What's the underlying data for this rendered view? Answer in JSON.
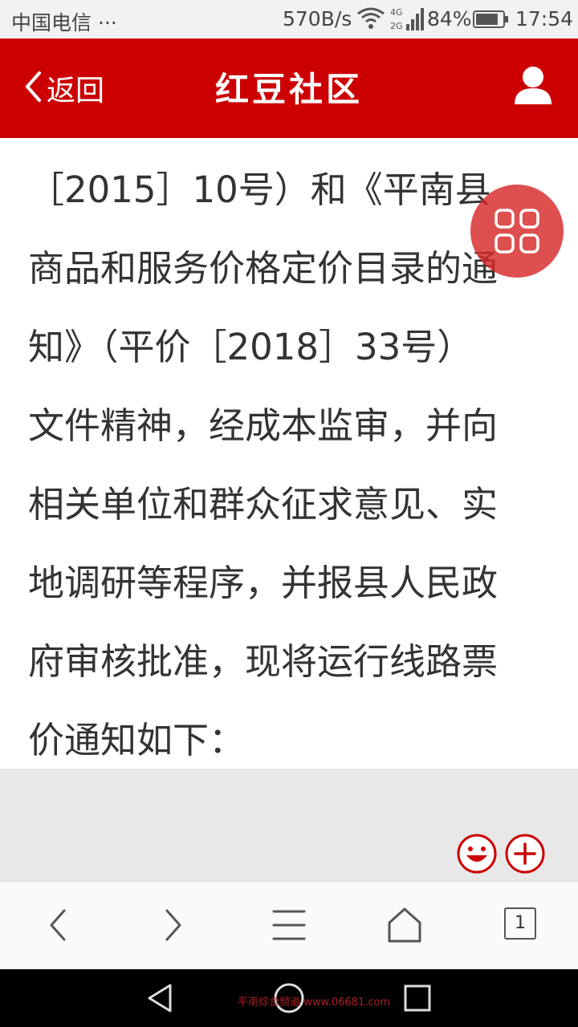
{
  "status_bar": {
    "carrier": "中国电信 ···",
    "net_speed": "570B/s",
    "network_label": "4G 2G",
    "battery_percent": "84%",
    "battery_level": 0.84,
    "time": "17:54"
  },
  "header": {
    "back_label": "返回",
    "title": "红豆社区",
    "background": "#cc0000"
  },
  "article": {
    "lines": [
      "［2015］10号）和《平南县",
      "商品和服务价格定价目录的通",
      "知》（平价［2018］33号）",
      "文件精神，经成本监审，并向",
      "相关单位和群众征求意见、实",
      "地调研等程序，并报县人民政",
      "府审核批准，现将运行线路票",
      "价通知如下："
    ]
  },
  "comment_bar": {
    "emoji_icon": "smiley-icon",
    "plus_icon": "plus-icon"
  },
  "toolbar": {
    "tab_count": "1"
  },
  "watermark": {
    "text": "平南综合频道 www.06681.com"
  }
}
